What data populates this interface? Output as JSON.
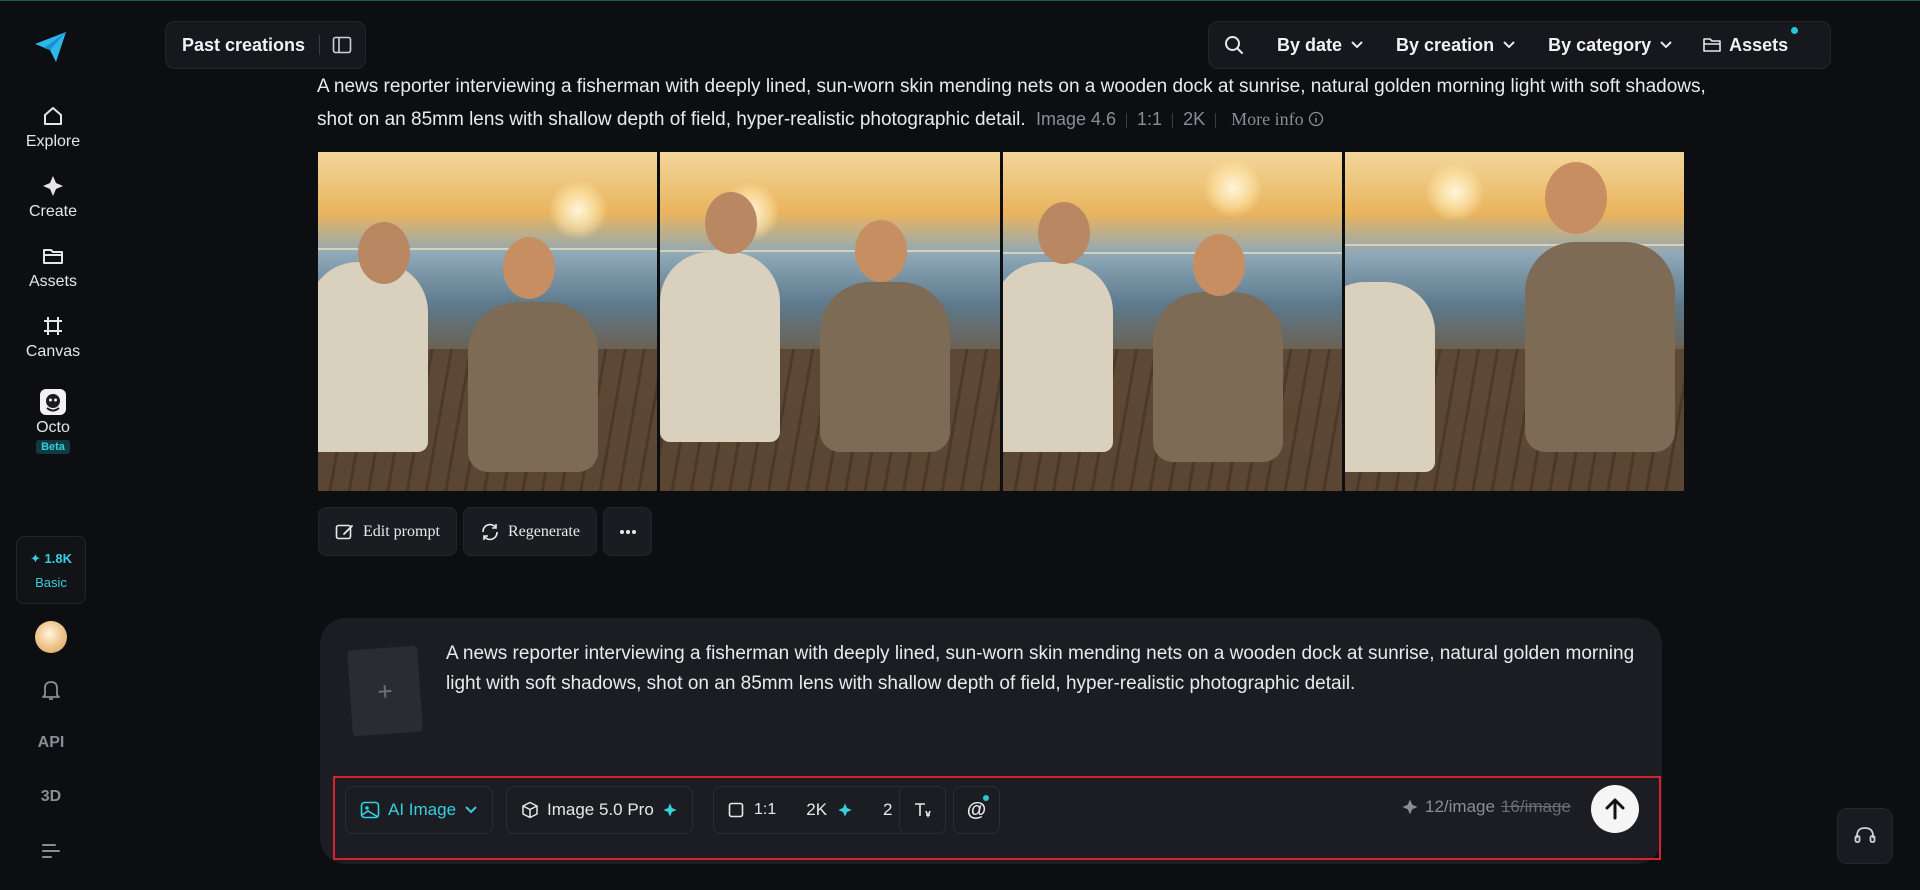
{
  "sidebar": {
    "logo": "paper-plane-logo",
    "items": [
      {
        "label": "Explore",
        "icon": "home-icon"
      },
      {
        "label": "Create",
        "icon": "sparkle-icon"
      },
      {
        "label": "Assets",
        "icon": "folder-icon"
      },
      {
        "label": "Canvas",
        "icon": "canvas-icon"
      },
      {
        "label": "Octo",
        "icon": "octo-icon",
        "badge": "Beta"
      }
    ],
    "credits": {
      "amount": "1.8K",
      "plan": "Basic"
    },
    "bottom": {
      "api": "API",
      "three_d": "3D"
    }
  },
  "topbar": {
    "past_creations": "Past creations",
    "filters": [
      "By date",
      "By creation",
      "By category"
    ],
    "assets": "Assets"
  },
  "creation": {
    "prompt": "A news reporter interviewing a fisherman with deeply lined, sun-worn skin mending nets on a wooden dock at sunrise, natural golden morning light with soft shadows, shot on an 85mm lens with shallow depth of field, hyper-realistic photographic detail.",
    "model": "Image 4.6",
    "ratio": "1:1",
    "resolution": "2K",
    "more_info": "More info",
    "actions": {
      "edit": "Edit prompt",
      "regenerate": "Regenerate"
    }
  },
  "composer": {
    "text": "A news reporter interviewing a fisherman with deeply lined, sun-worn skin mending nets on a wooden dock at sunrise, natural golden morning light with soft shadows, shot on an 85mm lens with shallow depth of field, hyper-realistic photographic detail.",
    "mode": "AI Image",
    "model": "Image 5.0 Pro",
    "ratio": "1:1",
    "resolution": "2K",
    "count": "2",
    "cost": "12/image",
    "old_cost": "16/image"
  },
  "colors": {
    "accent": "#35d0e0",
    "highlight": "#d3232d",
    "background": "#0d0e12"
  }
}
